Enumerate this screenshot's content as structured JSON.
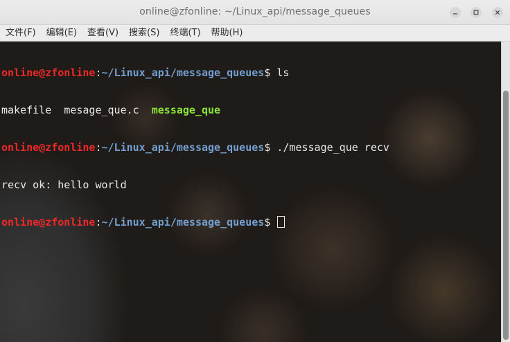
{
  "window": {
    "title": "online@zfonline: ~/Linux_api/message_queues"
  },
  "menu": [
    "文件(F)",
    "编辑(E)",
    "查看(V)",
    "搜索(S)",
    "终端(T)",
    "帮助(H)"
  ],
  "terminal": {
    "prompt_user": "online@zfonline",
    "prompt_sep": ":",
    "prompt_path": "~/Linux_api/message_queues",
    "prompt_symbol": "$",
    "cmd1": " ls",
    "ls_file1": "makefile",
    "ls_file2": "mesage_que.c",
    "ls_exec": "message_que",
    "cmd2": " ./message_que recv",
    "output": "recv ok: hello world"
  },
  "colors": {
    "prompt_user": "#ef2929",
    "prompt_path": "#729fcf",
    "executable": "#8ae234"
  }
}
